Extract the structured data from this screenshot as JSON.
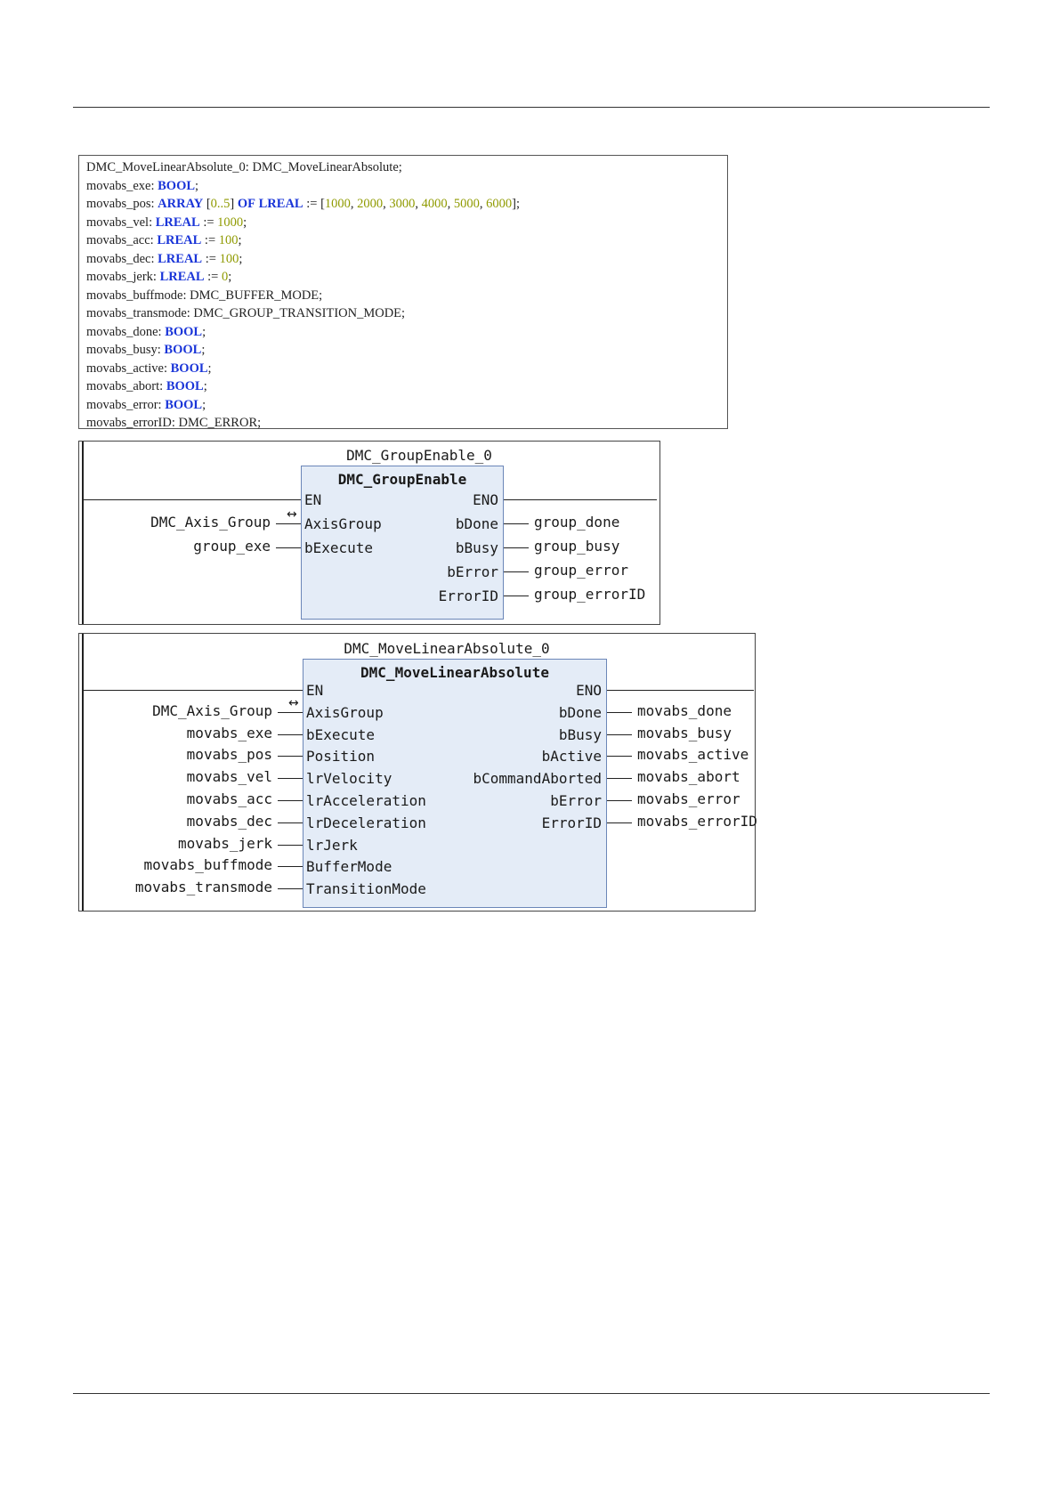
{
  "declarations": [
    [
      [
        "DMC_MoveLinearAbsolute_0: DMC_MoveLinearAbsolute;",
        "plain"
      ]
    ],
    [
      [
        "movabs_exe: ",
        "plain"
      ],
      [
        "BOOL",
        "kw"
      ],
      [
        ";",
        "plain"
      ]
    ],
    [
      [
        "movabs_pos: ",
        "plain"
      ],
      [
        "ARRAY",
        "kw"
      ],
      [
        " [",
        "plain"
      ],
      [
        "0..5",
        "num"
      ],
      [
        "] ",
        "plain"
      ],
      [
        "OF",
        "kw"
      ],
      [
        " ",
        "plain"
      ],
      [
        "LREAL",
        "kw"
      ],
      [
        " := [",
        "plain"
      ],
      [
        "1000",
        "num"
      ],
      [
        ", ",
        "plain"
      ],
      [
        "2000",
        "num"
      ],
      [
        ", ",
        "plain"
      ],
      [
        "3000",
        "num"
      ],
      [
        ", ",
        "plain"
      ],
      [
        "4000",
        "num"
      ],
      [
        ", ",
        "plain"
      ],
      [
        "5000",
        "num"
      ],
      [
        ", ",
        "plain"
      ],
      [
        "6000",
        "num"
      ],
      [
        "];",
        "plain"
      ]
    ],
    [
      [
        "movabs_vel: ",
        "plain"
      ],
      [
        "LREAL",
        "kw"
      ],
      [
        " := ",
        "plain"
      ],
      [
        "1000",
        "num"
      ],
      [
        ";",
        "plain"
      ]
    ],
    [
      [
        "movabs_acc: ",
        "plain"
      ],
      [
        "LREAL",
        "kw"
      ],
      [
        " := ",
        "plain"
      ],
      [
        "100",
        "num"
      ],
      [
        ";",
        "plain"
      ]
    ],
    [
      [
        "movabs_dec: ",
        "plain"
      ],
      [
        "LREAL",
        "kw"
      ],
      [
        " := ",
        "plain"
      ],
      [
        "100",
        "num"
      ],
      [
        ";",
        "plain"
      ]
    ],
    [
      [
        "movabs_jerk: ",
        "plain"
      ],
      [
        "LREAL",
        "kw"
      ],
      [
        " := ",
        "plain"
      ],
      [
        "0",
        "num"
      ],
      [
        ";",
        "plain"
      ]
    ],
    [
      [
        "movabs_buffmode: DMC_BUFFER_MODE;",
        "plain"
      ]
    ],
    [
      [
        "movabs_transmode: DMC_GROUP_TRANSITION_MODE;",
        "plain"
      ]
    ],
    [
      [
        "movabs_done: ",
        "plain"
      ],
      [
        "BOOL",
        "kw"
      ],
      [
        ";",
        "plain"
      ]
    ],
    [
      [
        "movabs_busy: ",
        "plain"
      ],
      [
        "BOOL",
        "kw"
      ],
      [
        ";",
        "plain"
      ]
    ],
    [
      [
        "movabs_active: ",
        "plain"
      ],
      [
        "BOOL",
        "kw"
      ],
      [
        ";",
        "plain"
      ]
    ],
    [
      [
        "movabs_abort: ",
        "plain"
      ],
      [
        "BOOL",
        "kw"
      ],
      [
        ";",
        "plain"
      ]
    ],
    [
      [
        "movabs_error: ",
        "plain"
      ],
      [
        "BOOL",
        "kw"
      ],
      [
        ";",
        "plain"
      ]
    ],
    [
      [
        "movabs_errorID: DMC_ERROR;",
        "plain"
      ]
    ]
  ],
  "group_enable_block": {
    "instance": "DMC_GroupEnable_0",
    "type": "DMC_GroupEnable",
    "en": "EN",
    "eno": "ENO",
    "inputs": [
      {
        "pin": "AxisGroup",
        "variable": "DMC_Axis_Group",
        "reference": true
      },
      {
        "pin": "bExecute",
        "variable": "group_exe",
        "reference": false
      }
    ],
    "outputs": [
      {
        "pin": "bDone",
        "variable": "group_done"
      },
      {
        "pin": "bBusy",
        "variable": "group_busy"
      },
      {
        "pin": "bError",
        "variable": "group_error"
      },
      {
        "pin": "ErrorID",
        "variable": "group_errorID"
      }
    ]
  },
  "move_linear_block": {
    "instance": "DMC_MoveLinearAbsolute_0",
    "type": "DMC_MoveLinearAbsolute",
    "en": "EN",
    "eno": "ENO",
    "inputs": [
      {
        "pin": "AxisGroup",
        "variable": "DMC_Axis_Group",
        "reference": true
      },
      {
        "pin": "bExecute",
        "variable": "movabs_exe",
        "reference": false
      },
      {
        "pin": "Position",
        "variable": "movabs_pos",
        "reference": false
      },
      {
        "pin": "lrVelocity",
        "variable": "movabs_vel",
        "reference": false
      },
      {
        "pin": "lrAcceleration",
        "variable": "movabs_acc",
        "reference": false
      },
      {
        "pin": "lrDeceleration",
        "variable": "movabs_dec",
        "reference": false
      },
      {
        "pin": "lrJerk",
        "variable": "movabs_jerk",
        "reference": false
      },
      {
        "pin": "BufferMode",
        "variable": "movabs_buffmode",
        "reference": false
      },
      {
        "pin": "TransitionMode",
        "variable": "movabs_transmode",
        "reference": false
      }
    ],
    "outputs": [
      {
        "pin": "bDone",
        "variable": "movabs_done"
      },
      {
        "pin": "bBusy",
        "variable": "movabs_busy"
      },
      {
        "pin": "bActive",
        "variable": "movabs_active"
      },
      {
        "pin": "bCommandAborted",
        "variable": "movabs_abort"
      },
      {
        "pin": "bError",
        "variable": "movabs_error"
      },
      {
        "pin": "ErrorID",
        "variable": "movabs_errorID"
      }
    ]
  },
  "reference_icon": "bidirectional-arrow-icon"
}
